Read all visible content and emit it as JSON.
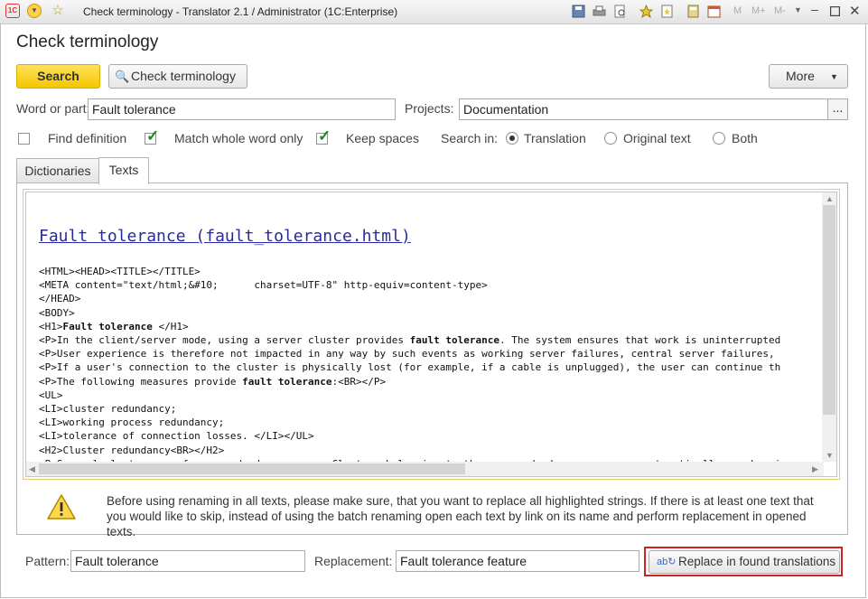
{
  "window": {
    "title": "Check terminology - Translator 2.1 / Administrator  (1C:Enterprise)",
    "memory_buttons": [
      "M",
      "M+",
      "M-"
    ]
  },
  "form": {
    "title": "Check terminology",
    "search_label": "Search",
    "check_terminology_label": "Check terminology",
    "more_label": "More"
  },
  "filters": {
    "word_label": "Word or part:",
    "word_value": "Fault tolerance",
    "projects_label": "Projects:",
    "projects_value": "Documentation",
    "projects_select": "..."
  },
  "options": {
    "find_definition": {
      "label": "Find definition",
      "checked": false
    },
    "match_whole_word": {
      "label": "Match whole word only",
      "checked": true
    },
    "keep_spaces": {
      "label": "Keep spaces",
      "checked": true
    },
    "search_in_label": "Search in:",
    "search_in": [
      {
        "label": "Translation",
        "selected": true
      },
      {
        "label": "Original text",
        "selected": false
      },
      {
        "label": "Both",
        "selected": false
      }
    ]
  },
  "tabs": [
    {
      "label": "Dictionaries",
      "active": false
    },
    {
      "label": "Texts",
      "active": true
    }
  ],
  "document": {
    "link": "Fault tolerance (fault_tolerance.html)",
    "lines": [
      "<HTML><HEAD><TITLE></TITLE>",
      "<META content=\"text/html;&#10;      charset=UTF-8\" http-equiv=content-type>",
      "</HEAD>",
      "<BODY>",
      "<H1>[[Fault tolerance]] </H1>",
      "<P>In the client/server mode, using a server cluster provides [[fault tolerance]]. The system ensures that work is uninterrupted",
      "<P>User experience is therefore not impacted in any way by such events as working server failures, central server failures,",
      "<P>If a user's connection to the cluster is physically lost (for example, if a cable is unplugged), the user can continue th",
      "<P>The following measures provide [[fault tolerance]]:<BR></P>",
      "<UL>",
      "<LI>cluster redundancy;",
      "<LI>working process redundancy;",
      "<LI>tolerance of connection losses. </LI></UL>",
      "<H2>Cluster redundancy<BR></H2>",
      "<P>Several clusters can form a redundancy group. Clusters belonging to the same redundancy group are automatically synchroni"
    ]
  },
  "warning": {
    "text": "Before using renaming in all texts, please make sure, that you want to replace all highlighted strings. If there is at least one text that you would like to skip, instead of using the batch renaming open each text by link on its name and perform replacement in opened texts."
  },
  "replace": {
    "pattern_label": "Pattern:",
    "pattern_value": "Fault tolerance",
    "replacement_label": "Replacement:",
    "replacement_value": "Fault tolerance feature",
    "button_label": "Replace in found translations"
  },
  "colors": {
    "accent_yellow": "#f5c500",
    "highlight_red": "#d42020",
    "link_blue": "#2a2aa0",
    "check_green": "#1a8a1a"
  }
}
